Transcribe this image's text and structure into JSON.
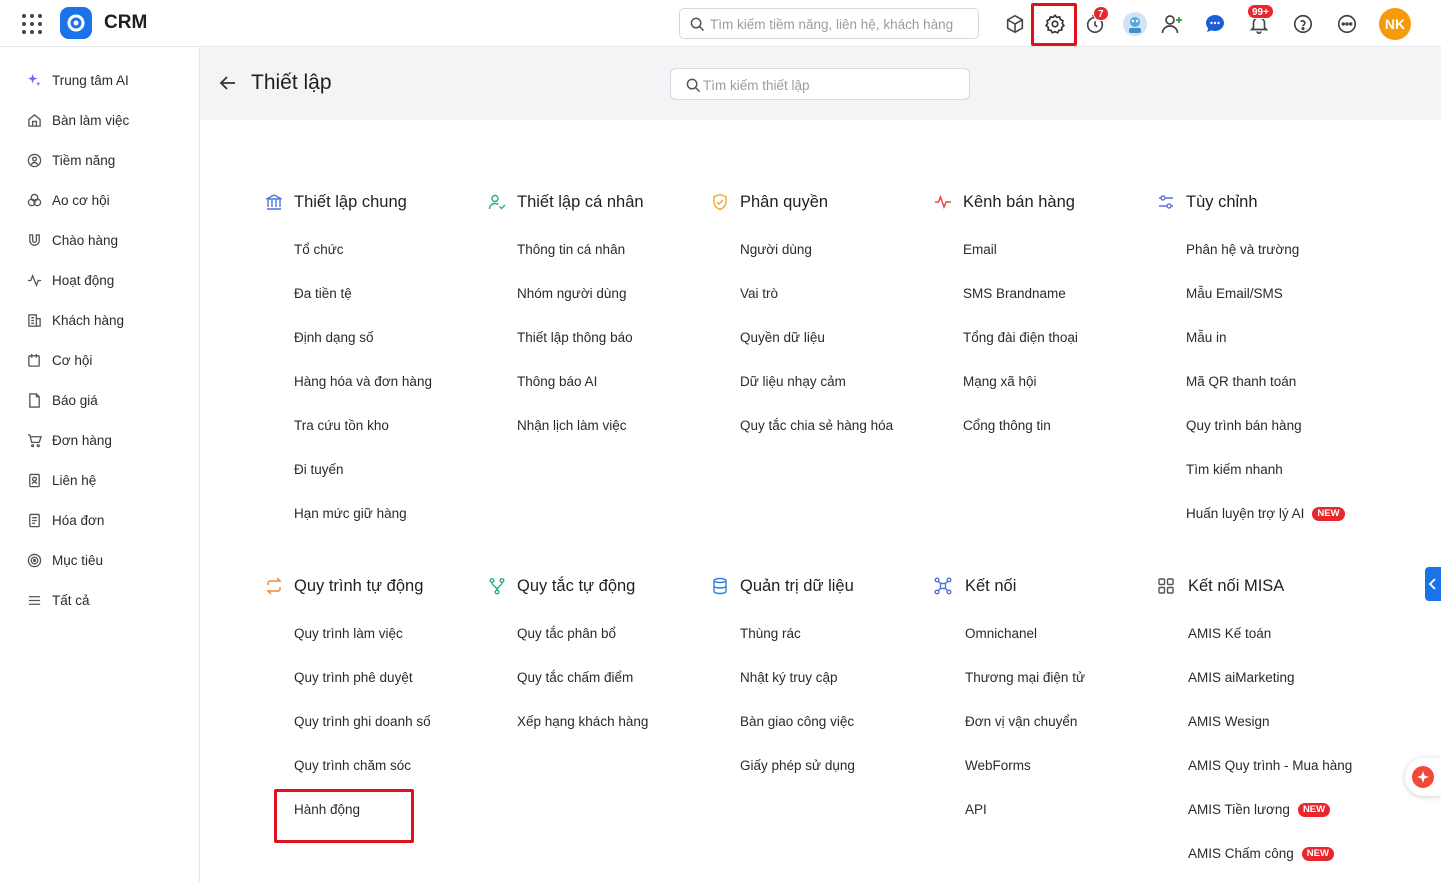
{
  "app": {
    "name": "CRM"
  },
  "topbar": {
    "search_placeholder": "Tìm kiếm tiềm năng, liên hệ, khách hàng",
    "icons": [
      "box-icon",
      "gear-icon",
      "clock-icon",
      "bot-avatar",
      "add-user-icon",
      "chat-icon",
      "bell-icon",
      "help-icon",
      "more-icon"
    ],
    "timer_badge": "7",
    "notification_badge": "99+",
    "user_initials": "NK",
    "avatar_color": "#f59a0b",
    "highlight_color": "#e0101a"
  },
  "sidebar": {
    "items": [
      {
        "label": "Trung tâm AI",
        "icon": "sparkle-icon"
      },
      {
        "label": "Bàn làm việc",
        "icon": "home-icon"
      },
      {
        "label": "Tiềm năng",
        "icon": "target-user-icon"
      },
      {
        "label": "Ao cơ hội",
        "icon": "pool-icon"
      },
      {
        "label": "Chào hàng",
        "icon": "magnet-icon"
      },
      {
        "label": "Hoạt động",
        "icon": "activity-icon"
      },
      {
        "label": "Khách hàng",
        "icon": "building-icon"
      },
      {
        "label": "Cơ hội",
        "icon": "opportunity-icon"
      },
      {
        "label": "Báo giá",
        "icon": "quote-icon"
      },
      {
        "label": "Đơn hàng",
        "icon": "cart-icon"
      },
      {
        "label": "Liên hệ",
        "icon": "contact-icon"
      },
      {
        "label": "Hóa đơn",
        "icon": "invoice-icon"
      },
      {
        "label": "Mục tiêu",
        "icon": "goal-icon"
      },
      {
        "label": "Tất cả",
        "icon": "menu-icon"
      }
    ]
  },
  "page": {
    "title": "Thiết lập",
    "search_placeholder": "Tìm kiếm thiết lập"
  },
  "sections": [
    {
      "title": "Thiết lập chung",
      "icon": "bank-icon",
      "items": [
        "Tổ chức",
        "Đa tiền tệ",
        "Định dạng số",
        "Hàng hóa và đơn hàng",
        "Tra cứu tồn kho",
        "Đi tuyến",
        "Hạn mức giữ hàng"
      ]
    },
    {
      "title": "Thiết lập cá nhân",
      "icon": "user-check-icon",
      "items": [
        "Thông tin cá nhân",
        "Nhóm người dùng",
        "Thiết lập thông báo",
        "Thông báo AI",
        "Nhận lịch làm việc"
      ]
    },
    {
      "title": "Phân quyền",
      "icon": "shield-icon",
      "items": [
        "Người dùng",
        "Vai trò",
        "Quyền dữ liệu",
        "Dữ liệu nhạy cảm",
        "Quy tắc chia sẻ hàng hóa"
      ]
    },
    {
      "title": "Kênh bán hàng",
      "icon": "pulse-icon",
      "items": [
        "Email",
        "SMS Brandname",
        "Tổng đài điện thoại",
        "Mạng xã hội",
        "Cổng thông tin"
      ]
    },
    {
      "title": "Tùy chỉnh",
      "icon": "sliders-icon",
      "items": [
        "Phân hệ và trường",
        "Mẫu Email/SMS",
        "Mẫu in",
        "Mã QR thanh toán",
        "Quy trình bán hàng",
        "Tìm kiếm nhanh",
        "Huấn luyện trợ lý AI"
      ]
    },
    {
      "title": "Quy trình tự động",
      "icon": "repeat-icon",
      "items": [
        "Quy trình làm việc",
        "Quy trình phê duyệt",
        "Quy trình ghi doanh số",
        "Quy trình chăm sóc",
        "Hành động"
      ]
    },
    {
      "title": "Quy tắc tự động",
      "icon": "branch-icon",
      "items": [
        "Quy tắc phân bổ",
        "Quy tắc chấm điểm",
        "Xếp hạng khách hàng"
      ]
    },
    {
      "title": "Quản trị dữ liệu",
      "icon": "database-icon",
      "items": [
        "Thùng rác",
        "Nhật ký truy cập",
        "Bàn giao công việc",
        "Giấy phép sử dụng"
      ]
    },
    {
      "title": "Kết nối",
      "icon": "network-icon",
      "items": [
        "Omnichanel",
        "Thương mại điện tử",
        "Đơn vị vận chuyển",
        "WebForms",
        "API"
      ]
    },
    {
      "title": "Kết nối MISA",
      "icon": "grid-icon",
      "items": [
        "AMIS Kế toán",
        "AMIS aiMarketing",
        "AMIS Wesign",
        "AMIS Quy trình - Mua hàng",
        "AMIS Tiền lương",
        "AMIS Chấm công"
      ]
    }
  ],
  "new_tag": "NEW"
}
